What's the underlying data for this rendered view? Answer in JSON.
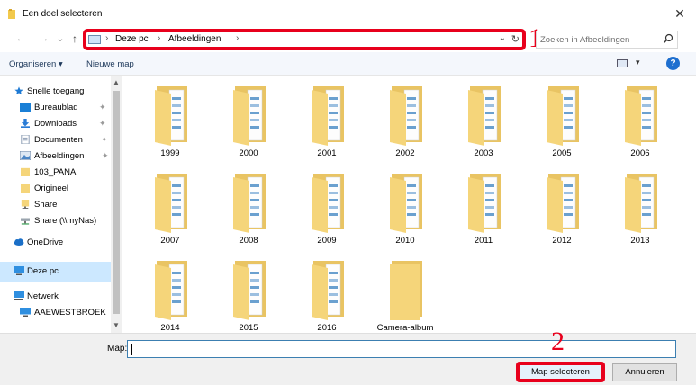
{
  "window": {
    "title": "Een doel selecteren",
    "close": "✕"
  },
  "nav": {
    "back": "←",
    "forward": "→",
    "recent": "⌄",
    "up": "↑",
    "breadcrumb": [
      "Deze pc",
      "Afbeeldingen"
    ],
    "separator": "›",
    "dropdown": "⌄",
    "refresh": "↻",
    "search_placeholder": "Zoeken in Afbeeldingen"
  },
  "toolbar": {
    "organize": "Organiseren ▾",
    "new_folder": "Nieuwe map",
    "view_dd": "▾",
    "help": "?"
  },
  "sidebar": {
    "items": [
      {
        "label": "Snelle toegang",
        "icon": "star-icon",
        "pinned": false
      },
      {
        "label": "Bureaublad",
        "icon": "desktop-icon",
        "pinned": true
      },
      {
        "label": "Downloads",
        "icon": "download-icon",
        "pinned": true
      },
      {
        "label": "Documenten",
        "icon": "document-icon",
        "pinned": true
      },
      {
        "label": "Afbeeldingen",
        "icon": "pictures-icon",
        "pinned": true
      },
      {
        "label": "103_PANA",
        "icon": "folder-icon",
        "pinned": false
      },
      {
        "label": "Origineel",
        "icon": "folder-icon",
        "pinned": false
      },
      {
        "label": "Share",
        "icon": "share-icon",
        "pinned": false
      },
      {
        "label": "Share (\\\\myNas)",
        "icon": "network-drive-icon",
        "pinned": false
      },
      {
        "label": "OneDrive",
        "icon": "cloud-icon",
        "pinned": false
      },
      {
        "label": "Deze pc",
        "icon": "computer-icon",
        "pinned": false,
        "selected": true
      },
      {
        "label": "Netwerk",
        "icon": "network-icon",
        "pinned": false
      },
      {
        "label": "AAEWESTBROEK",
        "icon": "computer-icon",
        "pinned": false
      }
    ],
    "pin_glyph": "✦"
  },
  "folders": [
    "1999",
    "2000",
    "2001",
    "2002",
    "2003",
    "2005",
    "2006",
    "2007",
    "2008",
    "2009",
    "2010",
    "2011",
    "2012",
    "2013",
    "2014",
    "2015",
    "2016",
    "Camera-album"
  ],
  "bottom": {
    "map_label": "Map:",
    "map_value": "",
    "select_button": "Map selecteren",
    "cancel_button": "Annuleren"
  },
  "annotations": {
    "one": "1",
    "two": "2"
  },
  "colors": {
    "highlight": "#e8001c",
    "folder": "#f5d57a",
    "selection": "#cce8ff"
  }
}
